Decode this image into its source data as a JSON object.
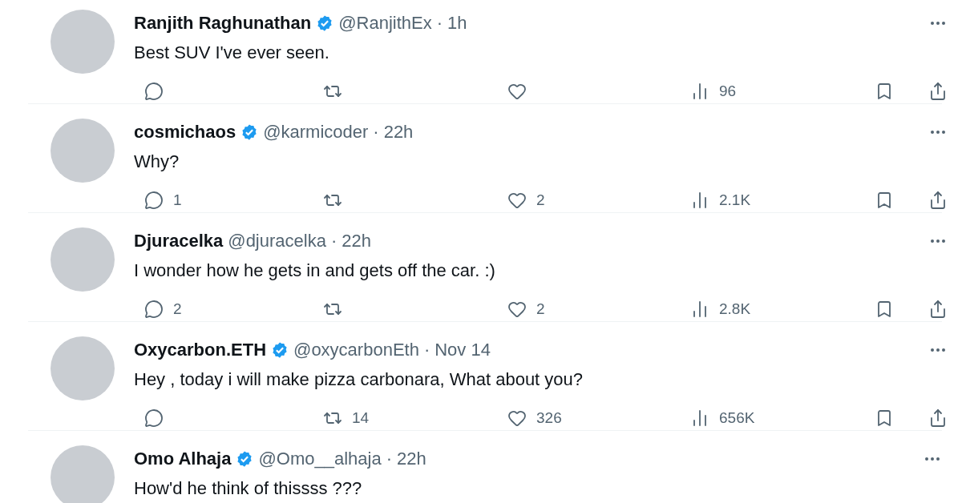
{
  "replies": [
    {
      "name": "Ranjith Raghunathan",
      "verified": true,
      "handle": "@RanjithEx",
      "separator": "·",
      "time": "1h",
      "text": "Best SUV I've ever seen.",
      "views": "96"
    },
    {
      "name": "cosmichaos",
      "verified": true,
      "handle": "@karmicoder",
      "separator": "·",
      "time": "22h",
      "text": "Why?",
      "replies": "1",
      "likes": "2",
      "views": "2.1K"
    },
    {
      "name": "Djuracelka",
      "verified": false,
      "handle": "@djuracelka",
      "separator": "·",
      "time": "22h",
      "text": "I wonder how he gets in and gets off the car. :)",
      "replies": "2",
      "likes": "2",
      "views": "2.8K"
    },
    {
      "name": "Oxycarbon.ETH",
      "verified": true,
      "handle": "@oxycarbonEth",
      "separator": "·",
      "time": "Nov 14",
      "text": "Hey , today i will make pizza carbonara, What about you?",
      "reposts": "14",
      "likes": "326",
      "views": "656K"
    },
    {
      "name": "Omo Alhaja",
      "verified": true,
      "handle": "@Omo__alhaja",
      "separator": "·",
      "time": "22h",
      "text": "How'd he think of thissss ???"
    }
  ]
}
